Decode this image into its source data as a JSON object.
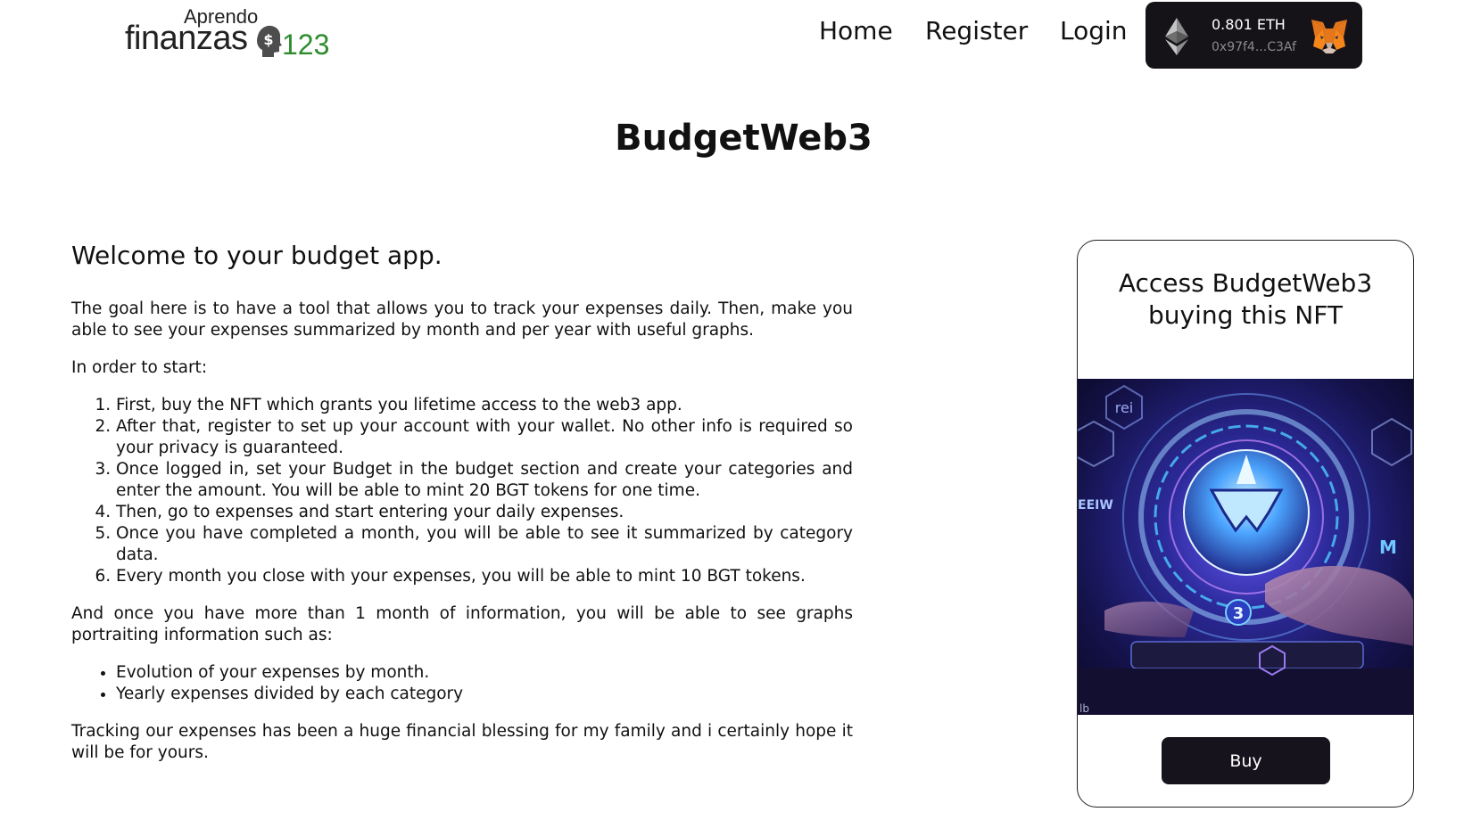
{
  "header": {
    "logo": {
      "top_text": "Aprendo",
      "main_text": "finanzas",
      "number_text": "123",
      "number_color": "#2e8b2e"
    },
    "nav": {
      "home": "Home",
      "register": "Register",
      "login": "Login"
    },
    "wallet": {
      "balance": "0.801 ETH",
      "address": "0x97f4...C3Af",
      "network_icon": "ethereum-icon",
      "wallet_icon": "metamask-fox-icon",
      "background": "#151318"
    }
  },
  "page_title": "BudgetWeb3",
  "main": {
    "welcome": "Welcome to your budget app.",
    "intro": "The goal here is to have a tool that allows you to track your expenses daily. Then, make you able to see your expenses summarized by month and per year with useful graphs.",
    "start_label": "In order to start:",
    "steps": [
      "First, buy the NFT which grants you lifetime access to the web3 app.",
      "After that, register to set up your account with your wallet. No other info is required so your privacy is guaranteed.",
      "Once logged in, set your Budget in the budget section and create your categories and enter the amount. You will be able to mint 20 BGT tokens for one time.",
      "Then, go to expenses and start entering your daily expenses.",
      "Once you have completed a month, you will be able to see it summarized by category data.",
      "Every month you close with your expenses, you will be able to mint 10 BGT tokens."
    ],
    "graphs_intro": "And once you have more than 1 month of information, you will be able to see graphs portraiting information such as:",
    "graph_items": [
      "Evolution of your expenses by month.",
      "Yearly expenses divided by each category"
    ],
    "closing": "Tracking our expenses has been a huge financial blessing for my family and i certainly hope it will be for yours."
  },
  "nft_card": {
    "title_line1": "Access BudgetWeb3",
    "title_line2": "buying this NFT",
    "buy_label": "Buy",
    "image_labels": {
      "top": "rei",
      "left": "EEIW",
      "right": "M",
      "bottom": "3",
      "corner": "lb"
    },
    "button_color": "#16131c"
  }
}
